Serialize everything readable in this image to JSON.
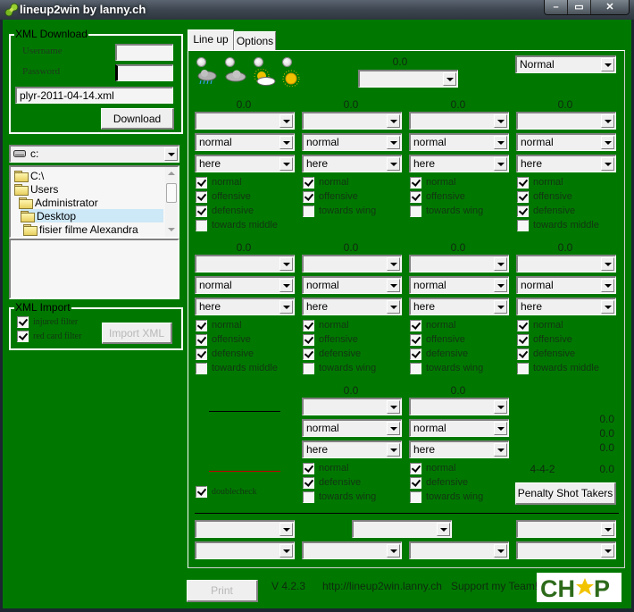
{
  "window": {
    "title": "lineup2win by lanny.ch",
    "buttons": {
      "minimize": "–",
      "maximize": "▭",
      "close": "✕"
    }
  },
  "xml_download": {
    "group_label": "XML Download",
    "username_label": "Username",
    "password_label": "Password",
    "username_value": "",
    "password_value": "",
    "file_value": "plyr-2011-04-14.xml",
    "download_button": "Download"
  },
  "file_browser": {
    "drive": "c:",
    "tree": [
      {
        "label": "C:\\",
        "level": 0,
        "selected": false
      },
      {
        "label": "Users",
        "level": 0,
        "selected": false
      },
      {
        "label": "Administrator",
        "level": 1,
        "selected": false
      },
      {
        "label": "Desktop",
        "level": 2,
        "selected": true
      },
      {
        "label": "fisier filme Alexandra",
        "level": 3,
        "selected": false
      }
    ]
  },
  "xml_import": {
    "group_label": "XML Import",
    "injured_filter": {
      "label": "injured filter",
      "checked": true
    },
    "red_card_filter": {
      "label": "red card filter",
      "checked": true
    },
    "import_button": "Import XML"
  },
  "tabs": [
    {
      "label": "Line up",
      "active": true
    },
    {
      "label": "Options",
      "active": false
    }
  ],
  "weather": {
    "options": [
      "rain",
      "overcast",
      "partially cloudy",
      "sunny"
    ],
    "selected": null
  },
  "top": {
    "keeper_rating": "0.0",
    "keeper_player": "",
    "attitude": "Normal"
  },
  "positions": [
    {
      "rating": "0.0",
      "player": "",
      "behaviour": "normal",
      "location": "here",
      "orders": [
        {
          "label": "normal",
          "checked": true
        },
        {
          "label": "offensive",
          "checked": true
        },
        {
          "label": "defensive",
          "checked": true
        },
        {
          "label": "towards middle",
          "checked": false
        }
      ]
    },
    {
      "rating": "0.0",
      "player": "",
      "behaviour": "normal",
      "location": "here",
      "orders": [
        {
          "label": "normal",
          "checked": true
        },
        {
          "label": "offensive",
          "checked": true
        },
        {
          "label": "towards wing",
          "checked": false
        }
      ]
    },
    {
      "rating": "0.0",
      "player": "",
      "behaviour": "normal",
      "location": "here",
      "orders": [
        {
          "label": "normal",
          "checked": true
        },
        {
          "label": "offensive",
          "checked": true
        },
        {
          "label": "towards wing",
          "checked": false
        }
      ]
    },
    {
      "rating": "0.0",
      "player": "",
      "behaviour": "normal",
      "location": "here",
      "orders": [
        {
          "label": "normal",
          "checked": true
        },
        {
          "label": "offensive",
          "checked": true
        },
        {
          "label": "defensive",
          "checked": true
        },
        {
          "label": "towards middle",
          "checked": false
        }
      ]
    },
    {
      "rating": "0.0",
      "player": "",
      "behaviour": "normal",
      "location": "here",
      "orders": [
        {
          "label": "normal",
          "checked": true
        },
        {
          "label": "offensive",
          "checked": true
        },
        {
          "label": "defensive",
          "checked": true
        },
        {
          "label": "towards middle",
          "checked": false
        }
      ]
    },
    {
      "rating": "0.0",
      "player": "",
      "behaviour": "normal",
      "location": "here",
      "orders": [
        {
          "label": "normal",
          "checked": true
        },
        {
          "label": "offensive",
          "checked": true
        },
        {
          "label": "defensive",
          "checked": true
        },
        {
          "label": "towards wing",
          "checked": false
        }
      ]
    },
    {
      "rating": "0.0",
      "player": "",
      "behaviour": "normal",
      "location": "here",
      "orders": [
        {
          "label": "normal",
          "checked": true
        },
        {
          "label": "offensive",
          "checked": true
        },
        {
          "label": "defensive",
          "checked": true
        },
        {
          "label": "towards wing",
          "checked": false
        }
      ]
    },
    {
      "rating": "0.0",
      "player": "",
      "behaviour": "normal",
      "location": "here",
      "orders": [
        {
          "label": "normal",
          "checked": true
        },
        {
          "label": "offensive",
          "checked": true
        },
        {
          "label": "defensive",
          "checked": true
        },
        {
          "label": "towards middle",
          "checked": false
        }
      ]
    },
    {
      "rating": "0.0",
      "player": "",
      "behaviour": "normal",
      "location": "here",
      "orders": [
        {
          "label": "normal",
          "checked": true
        },
        {
          "label": "defensive",
          "checked": true
        },
        {
          "label": "towards wing",
          "checked": false
        }
      ]
    },
    {
      "rating": "0.0",
      "player": "",
      "behaviour": "normal",
      "location": "here",
      "orders": [
        {
          "label": "normal",
          "checked": true
        },
        {
          "label": "defensive",
          "checked": true
        },
        {
          "label": "towards wing",
          "checked": false
        }
      ]
    }
  ],
  "summary": {
    "values": [
      "0.0",
      "0.0",
      "0.0"
    ],
    "formation": "4-4-2",
    "formation_value": "0.0",
    "doublecheck": {
      "label": "doublecheck",
      "checked": true
    },
    "penalty_button": "Penalty Shot Takers",
    "line_colors": {
      "top": "#000000",
      "bottom": "#c00000"
    }
  },
  "substitutes": {
    "row1": [
      "",
      "",
      ""
    ],
    "row2": [
      "",
      "",
      "",
      ""
    ]
  },
  "footer": {
    "print_button": "Print",
    "version": "V 4.2.3",
    "url": "http://lineup2win.lanny.ch",
    "support": "Support my Team!",
    "logo": "CHPP"
  },
  "colors": {
    "background": "#007800",
    "logo_green": "#2d6a1a",
    "logo_star": "#f2c400"
  }
}
